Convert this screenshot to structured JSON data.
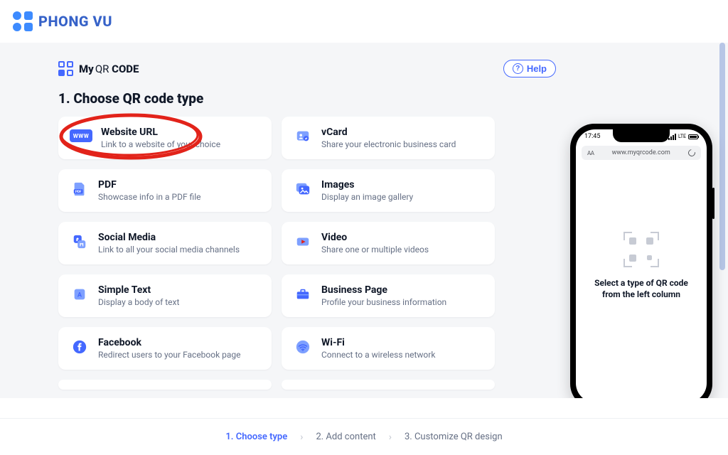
{
  "logo": {
    "text": "PHONG VU"
  },
  "brand": {
    "prefix": "My",
    "middle": "QR",
    "suffix": "CODE"
  },
  "help_label": "Help",
  "section_title": "1. Choose QR code type",
  "cards": [
    {
      "title": "Website URL",
      "subtitle": "Link to a website of your choice"
    },
    {
      "title": "vCard",
      "subtitle": "Share your electronic business card"
    },
    {
      "title": "PDF",
      "subtitle": "Showcase info in a PDF file"
    },
    {
      "title": "Images",
      "subtitle": "Display an image gallery"
    },
    {
      "title": "Social Media",
      "subtitle": "Link to all your social media channels"
    },
    {
      "title": "Video",
      "subtitle": "Share one or multiple videos"
    },
    {
      "title": "Simple Text",
      "subtitle": "Display a body of text"
    },
    {
      "title": "Business Page",
      "subtitle": "Profile your business information"
    },
    {
      "title": "Facebook",
      "subtitle": "Redirect users to your Facebook page"
    },
    {
      "title": "Wi-Fi",
      "subtitle": "Connect to a wireless network"
    }
  ],
  "phone": {
    "time": "17:45",
    "carrier": "LTE",
    "url": "www.myqrcode.com",
    "message": "Select a type of QR code from the left column"
  },
  "steps": {
    "s1": "1. Choose type",
    "s2": "2. Add content",
    "s3": "3. Customize QR design"
  }
}
